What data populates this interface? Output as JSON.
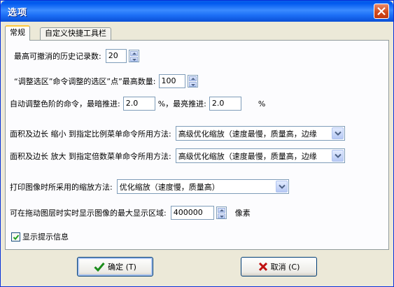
{
  "window": {
    "title": "选项",
    "close_label": "close"
  },
  "tabs": [
    {
      "label": "常规",
      "active": true
    },
    {
      "label": "自定义快捷工具栏",
      "active": false
    }
  ],
  "settings": {
    "history": {
      "label": "最高可撤消的历史记录数:",
      "value": "20"
    },
    "adjust_selection": {
      "label": "“调整选区”命令调整的选区”点”最高数量:",
      "value": "100"
    },
    "auto_levels": {
      "label": "自动调整色阶的命令，最暗推进:",
      "dark_value": "2.0",
      "mid_label": "%，最亮推进:",
      "light_value": "2.0",
      "unit": "%"
    },
    "shrink": {
      "label": "面积及边长  缩小  到指定比例菜单命令所用方法:",
      "selected": "高级优化缩放（速度最慢，质量高，边缘"
    },
    "enlarge": {
      "label": "面积及边长  放大  到指定倍数菜单命令所用方法:",
      "selected": "高级优化缩放（速度最慢，质量高，边缘"
    },
    "print_scale": {
      "label": "打印图像时所采用的缩放方法:",
      "selected": "优化缩放（速度慢，质量高）"
    },
    "max_display": {
      "label": "可在拖动图层时实时显示图像的最大显示区域:",
      "value": "400000",
      "unit": "像素"
    },
    "show_tips": {
      "label": "显示提示信息",
      "checked": true
    }
  },
  "buttons": {
    "ok": "确定 (T)",
    "cancel": "取消 (C)"
  },
  "colors": {
    "title_bar": "#1c6ef5",
    "close": "#d24a1c",
    "ok_icon": "#1a8c1a",
    "cancel_icon": "#c01010"
  }
}
